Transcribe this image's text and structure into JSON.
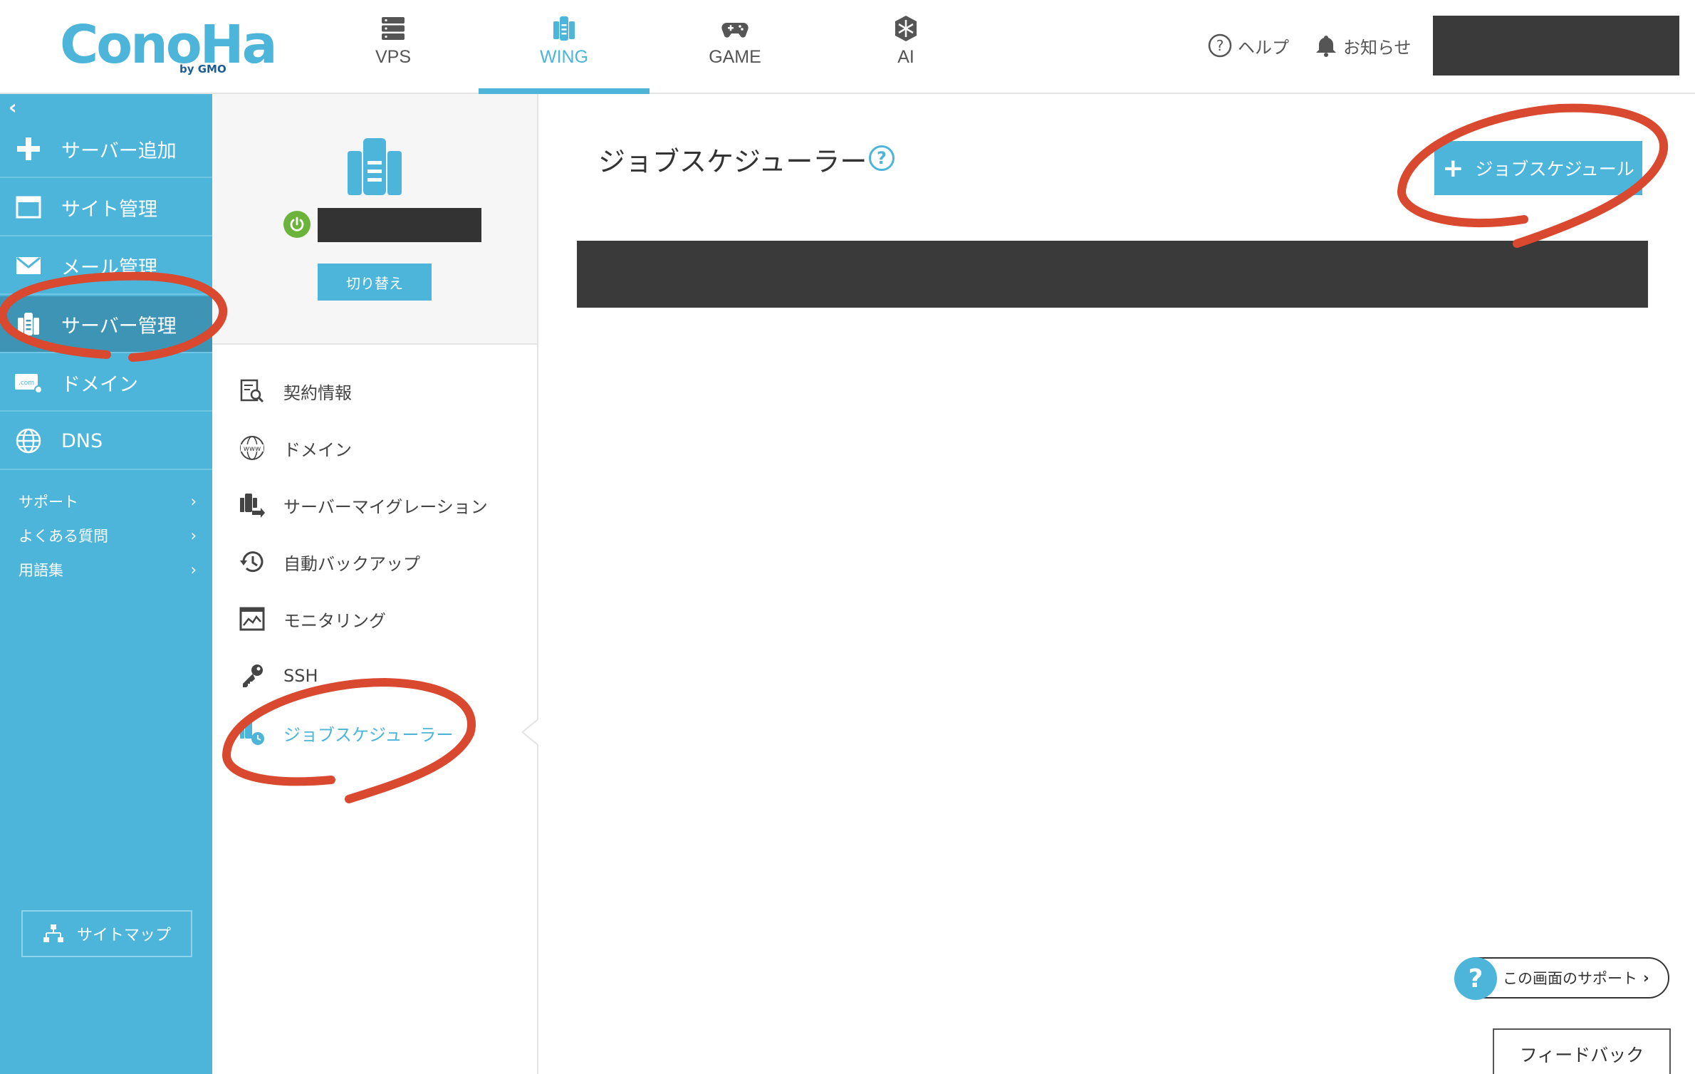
{
  "brand": {
    "logo_text": "ConoHa",
    "logo_sub": "by GMO"
  },
  "top_nav": [
    {
      "label": "VPS",
      "icon": "server-rack-icon"
    },
    {
      "label": "WING",
      "icon": "wing-server-icon",
      "active": true
    },
    {
      "label": "GAME",
      "icon": "gamepad-icon"
    },
    {
      "label": "AI",
      "icon": "ai-chip-icon"
    }
  ],
  "header": {
    "help_label": "ヘルプ",
    "notice_label": "お知らせ"
  },
  "sidebar": {
    "items": [
      {
        "label": "サーバー追加",
        "icon": "plus-icon"
      },
      {
        "label": "サイト管理",
        "icon": "window-icon"
      },
      {
        "label": "メール管理",
        "icon": "mail-icon"
      },
      {
        "label": "サーバー管理",
        "icon": "server-icon",
        "active": true
      },
      {
        "label": "ドメイン",
        "icon": "domain-icon"
      },
      {
        "label": "DNS",
        "icon": "globe-icon"
      }
    ],
    "links": [
      {
        "label": "サポート"
      },
      {
        "label": "よくある質問"
      },
      {
        "label": "用語集"
      }
    ],
    "sitemap_label": "サイトマップ"
  },
  "server_panel": {
    "switch_label": "切り替え",
    "menu": [
      {
        "label": "契約情報",
        "icon": "contract-search-icon"
      },
      {
        "label": "ドメイン",
        "icon": "www-globe-icon"
      },
      {
        "label": "サーバーマイグレーション",
        "icon": "migration-icon"
      },
      {
        "label": "自動バックアップ",
        "icon": "backup-history-icon"
      },
      {
        "label": "モニタリング",
        "icon": "monitoring-chart-icon"
      },
      {
        "label": "SSH",
        "icon": "key-icon"
      },
      {
        "label": "ジョブスケジューラー",
        "icon": "job-scheduler-icon",
        "active": true
      }
    ]
  },
  "main": {
    "title": "ジョブスケジューラー",
    "add_button_label": "ジョブスケジュール",
    "support_label": "この画面のサポート",
    "feedback_label": "フィードバック"
  },
  "colors": {
    "accent": "#4cb5d9",
    "sidebar_active": "#3d94b4",
    "annotation": "#d9492f",
    "power": "#6bb33a"
  }
}
